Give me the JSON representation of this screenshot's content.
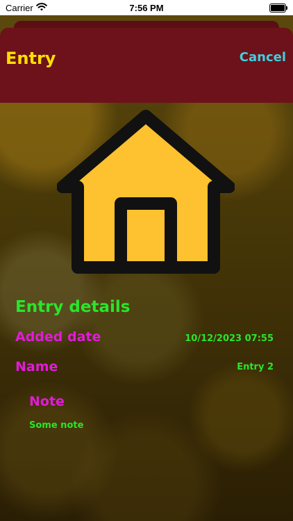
{
  "status_bar": {
    "carrier": "Carrier",
    "time": "7:56 PM"
  },
  "nav": {
    "title": "Entry",
    "cancel_label": "Cancel"
  },
  "illustration": {
    "icon": "house-icon",
    "fill_color": "#FEC12F",
    "stroke_color": "#111111"
  },
  "details": {
    "section_title": "Entry details",
    "added_date_label": "Added date",
    "added_date_value": "10/12/2023 07:55",
    "name_label": "Name",
    "name_value": "Entry 2",
    "note_label": "Note",
    "note_value": "Some note"
  },
  "colors": {
    "nav_background": "#6D121A",
    "title": "#FFE000",
    "cancel": "#3FD0E0",
    "section_title": "#29E62A",
    "label": "#E21BD7",
    "value": "#29E62A"
  }
}
